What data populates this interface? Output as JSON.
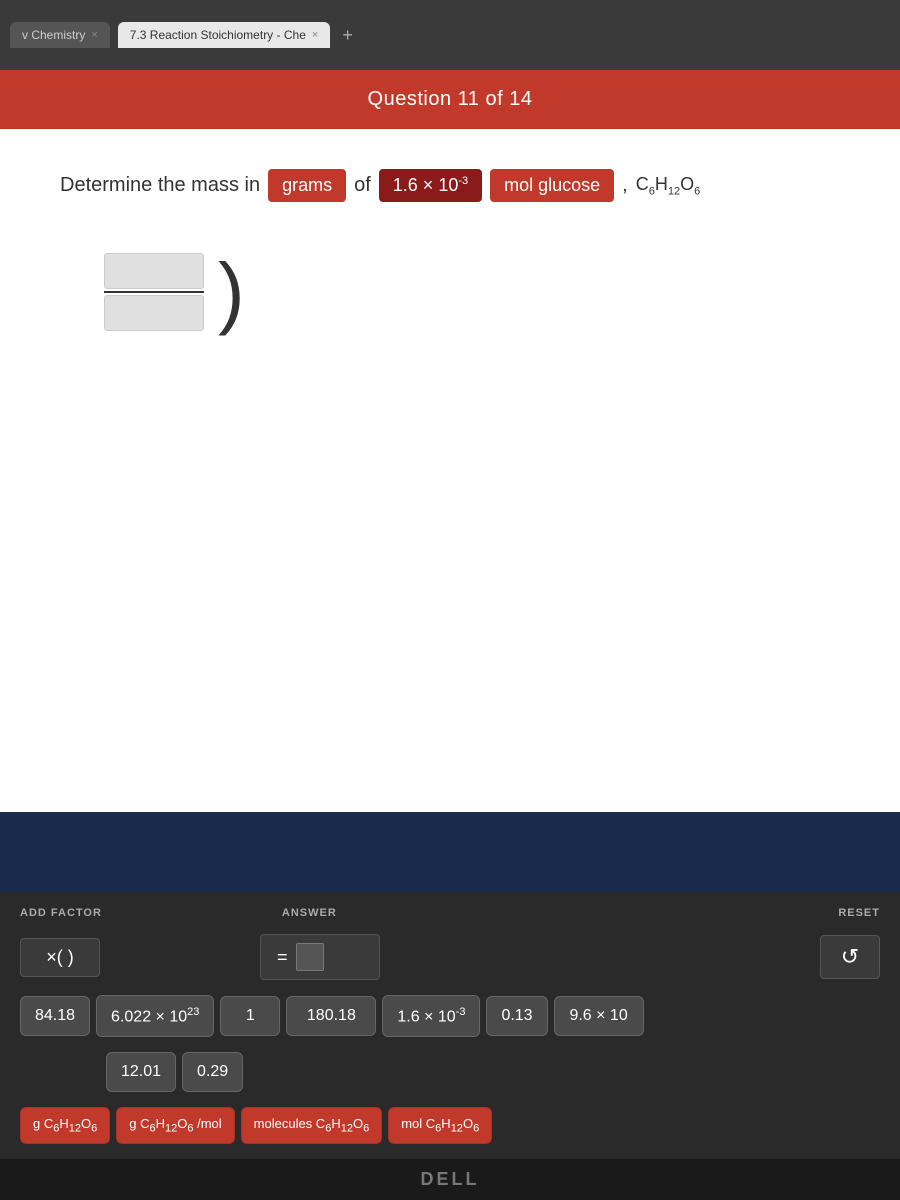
{
  "browser": {
    "tab_inactive_label": "v Chemistry",
    "tab_active_label": "7.3 Reaction Stoichiometry - Che",
    "tab_close": "×",
    "tab_plus": "+",
    "tab_inactive_close": "×"
  },
  "header": {
    "question_label": "Question 11 of 14"
  },
  "question": {
    "prefix": "Determine the mass in",
    "unit_label": "grams",
    "of_text": "of",
    "quantity": "1.6 × 10⁻³",
    "unit2": "mol glucose",
    "comma": ",",
    "formula": "C₆H₁₂O₆"
  },
  "controls": {
    "add_factor_label": "ADD FACTOR",
    "answer_label": "ANSWER",
    "reset_label": "RESET",
    "factor_display": "×(  )",
    "answer_equals": "=",
    "reset_icon": "↺"
  },
  "tiles": {
    "numbers": [
      {
        "value": "84.18"
      },
      {
        "value": "6.022 × 10²³"
      },
      {
        "value": "1"
      },
      {
        "value": "180.18"
      },
      {
        "value": "1.6 × 10⁻³"
      },
      {
        "value": "0.13"
      },
      {
        "value": "9.6 × 10"
      }
    ],
    "numbers2": [
      {
        "value": "12.01"
      },
      {
        "value": "0.29"
      }
    ],
    "units": [
      {
        "value": "g C₆H₁₂O₆"
      },
      {
        "value": "g C₆H₁₂O₆ /mol"
      },
      {
        "value": "molecules C₆H₁₂O₆"
      },
      {
        "value": "mol C₆H₁₂O₆"
      }
    ]
  },
  "dell": {
    "logo": "DELL"
  }
}
